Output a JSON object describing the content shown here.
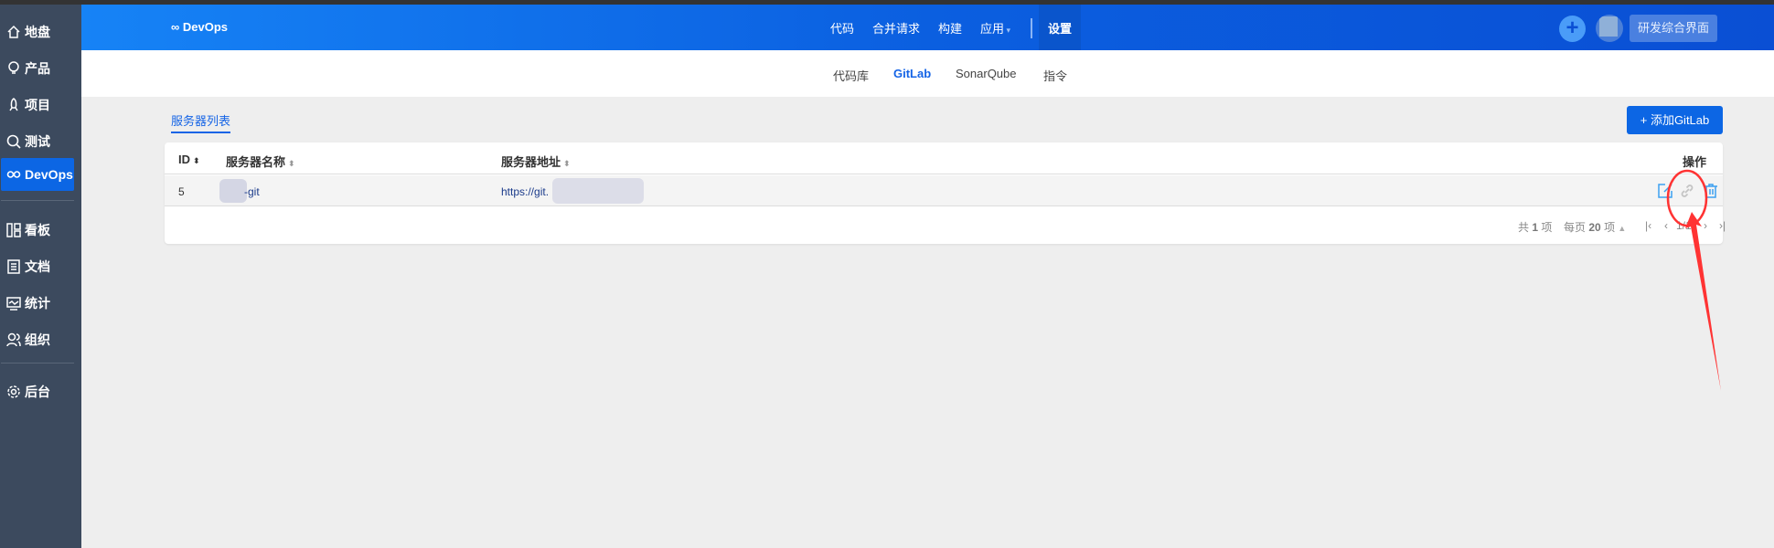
{
  "sidebar": {
    "items": [
      {
        "label": "地盘",
        "icon": "home-icon"
      },
      {
        "label": "产品",
        "icon": "lightbulb-icon"
      },
      {
        "label": "项目",
        "icon": "rocket-icon"
      },
      {
        "label": "测试",
        "icon": "search-icon"
      },
      {
        "label": "DevOps",
        "icon": "infinity-icon",
        "active": true
      },
      {
        "label": "看板",
        "icon": "kanban-icon"
      },
      {
        "label": "文档",
        "icon": "document-icon"
      },
      {
        "label": "统计",
        "icon": "chart-icon"
      },
      {
        "label": "组织",
        "icon": "users-icon"
      },
      {
        "label": "后台",
        "icon": "gear-icon"
      }
    ]
  },
  "header": {
    "logo": "∞ DevOps",
    "nav": [
      "代码",
      "合并请求",
      "构建",
      "应用",
      "设置"
    ],
    "active_nav": "设置",
    "plus": "+",
    "app_button": "研发综合界面"
  },
  "subnav": {
    "items": [
      "代码库",
      "GitLab",
      "SonarQube",
      "指令"
    ],
    "active": "GitLab"
  },
  "main": {
    "tab": "服务器列表",
    "add_button": "+ 添加GitLab",
    "table": {
      "columns": [
        "ID",
        "服务器名称",
        "服务器地址",
        "操作"
      ],
      "rows": [
        {
          "id": "5",
          "name": "-git",
          "url": "https://git."
        }
      ]
    },
    "pager": {
      "total_prefix": "共",
      "total": "1",
      "total_suffix": "项",
      "per_page_prefix": "每页",
      "per_page": "20",
      "per_page_suffix": "项",
      "page": "1/1"
    }
  },
  "colors": {
    "accent": "#0c66e4",
    "sidebar": "#3c4a5e",
    "annotation": "#ff3333"
  }
}
